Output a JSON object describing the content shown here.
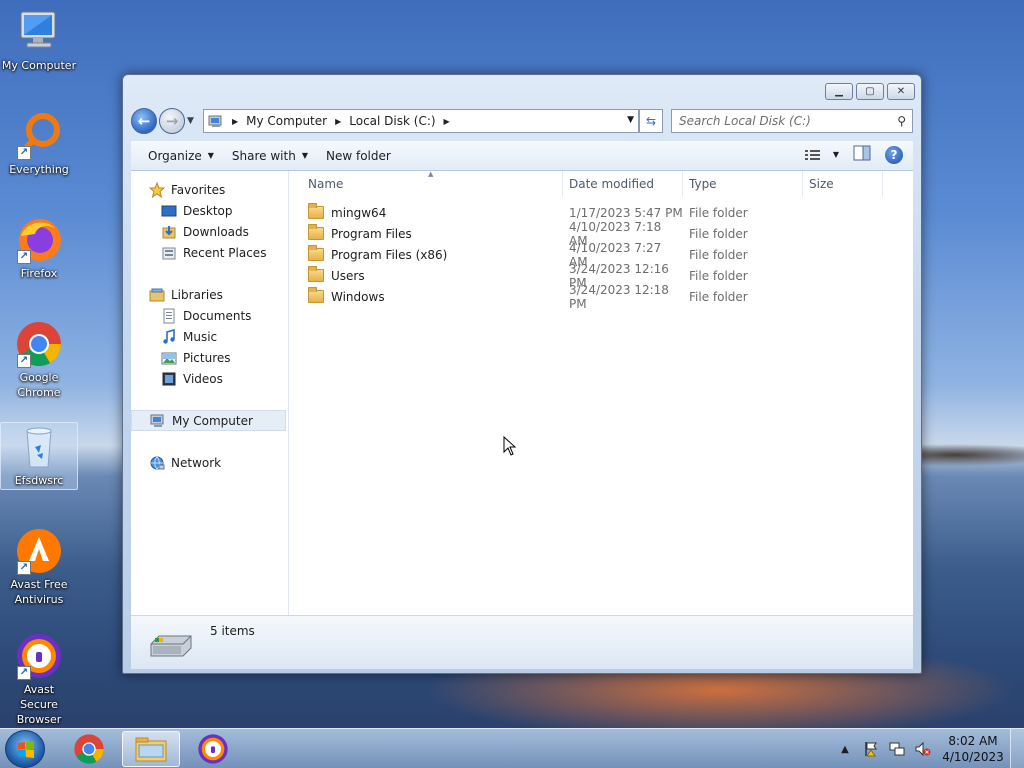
{
  "desktop": {
    "icons": [
      {
        "label": "My Computer"
      },
      {
        "label": "Everything"
      },
      {
        "label": "Firefox"
      },
      {
        "label": "Google Chrome"
      },
      {
        "label": "Efsdwsrc"
      },
      {
        "label": "Avast Free Antivirus"
      },
      {
        "label": "Avast Secure Browser"
      }
    ]
  },
  "explorer": {
    "address": {
      "crumbs": [
        "My Computer",
        "Local Disk (C:)"
      ]
    },
    "search": {
      "placeholder": "Search Local Disk (C:)"
    },
    "toolbar": {
      "organize": "Organize",
      "share_with": "Share with",
      "new_folder": "New folder"
    },
    "navpane": {
      "favorites": {
        "label": "Favorites",
        "items": [
          "Desktop",
          "Downloads",
          "Recent Places"
        ]
      },
      "libraries": {
        "label": "Libraries",
        "items": [
          "Documents",
          "Music",
          "Pictures",
          "Videos"
        ]
      },
      "computer": "My Computer",
      "network": "Network"
    },
    "columns": {
      "name": "Name",
      "date": "Date modified",
      "type": "Type",
      "size": "Size"
    },
    "files": [
      {
        "name": "mingw64",
        "date": "1/17/2023 5:47 PM",
        "type": "File folder"
      },
      {
        "name": "Program Files",
        "date": "4/10/2023 7:18 AM",
        "type": "File folder"
      },
      {
        "name": "Program Files (x86)",
        "date": "4/10/2023 7:27 AM",
        "type": "File folder"
      },
      {
        "name": "Users",
        "date": "3/24/2023 12:16 PM",
        "type": "File folder"
      },
      {
        "name": "Windows",
        "date": "3/24/2023 12:18 PM",
        "type": "File folder"
      }
    ],
    "status": {
      "count": "5 items"
    }
  },
  "taskbar": {
    "clock": {
      "time": "8:02 AM",
      "date": "4/10/2023"
    }
  }
}
